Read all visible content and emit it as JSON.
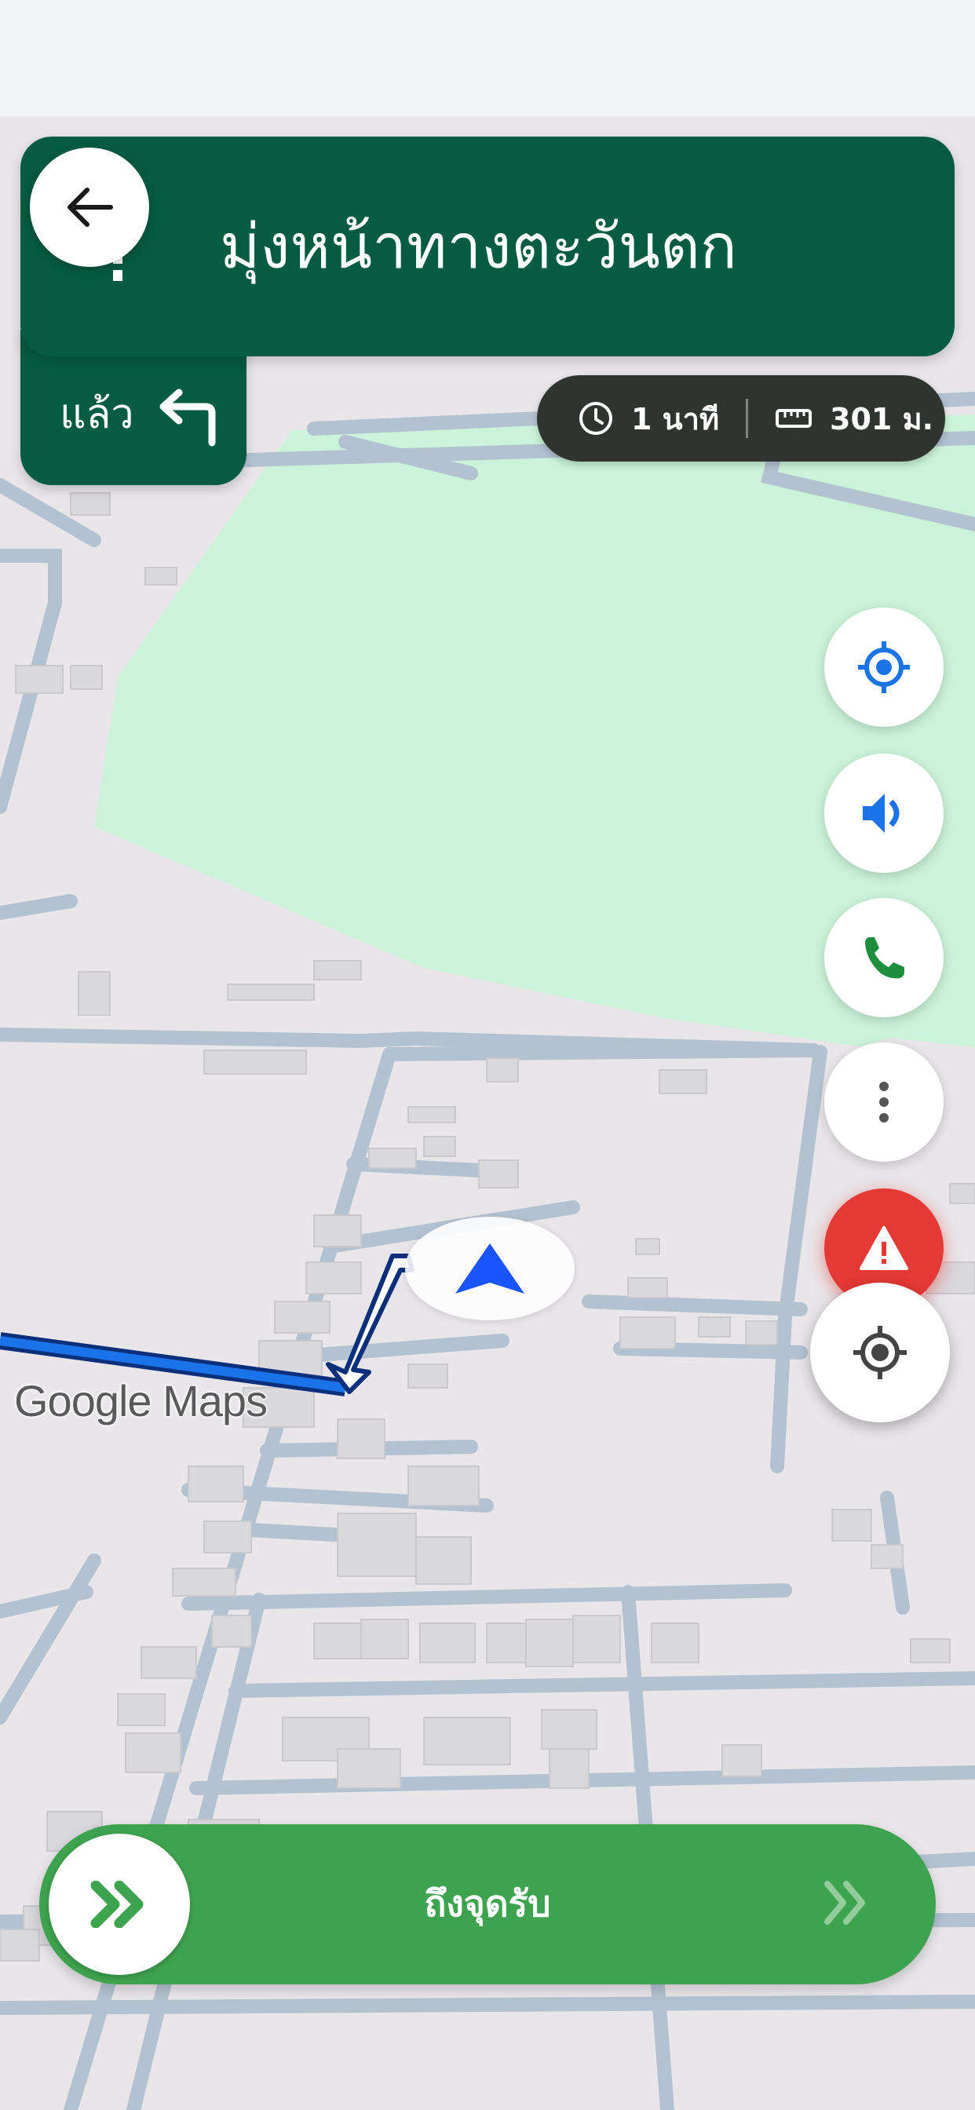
{
  "navigation": {
    "instruction": "มุ่งหน้าทางตะวันตก",
    "then_label": "แล้ว",
    "then_icon": "turn-left-icon",
    "back_icon": "arrow-left-icon"
  },
  "trip": {
    "duration": "1 นาที",
    "distance": "301 ม."
  },
  "map": {
    "attribution": "Google Maps",
    "route_color": "#1a73e8",
    "park_color": "#cbf3d9"
  },
  "actions": {
    "locate_icon": "crosshair-icon",
    "sound_icon": "speaker-icon",
    "call_icon": "phone-icon",
    "more_icon": "more-vertical-icon",
    "alert_icon": "warning-icon",
    "recenter_icon": "gps-target-icon"
  },
  "slide_action": {
    "label": "ถึงจุดรับ",
    "color": "#3ea34f"
  },
  "colors": {
    "banner": "#055c41",
    "alert": "#e53935",
    "accent_blue": "#1a73e8"
  }
}
